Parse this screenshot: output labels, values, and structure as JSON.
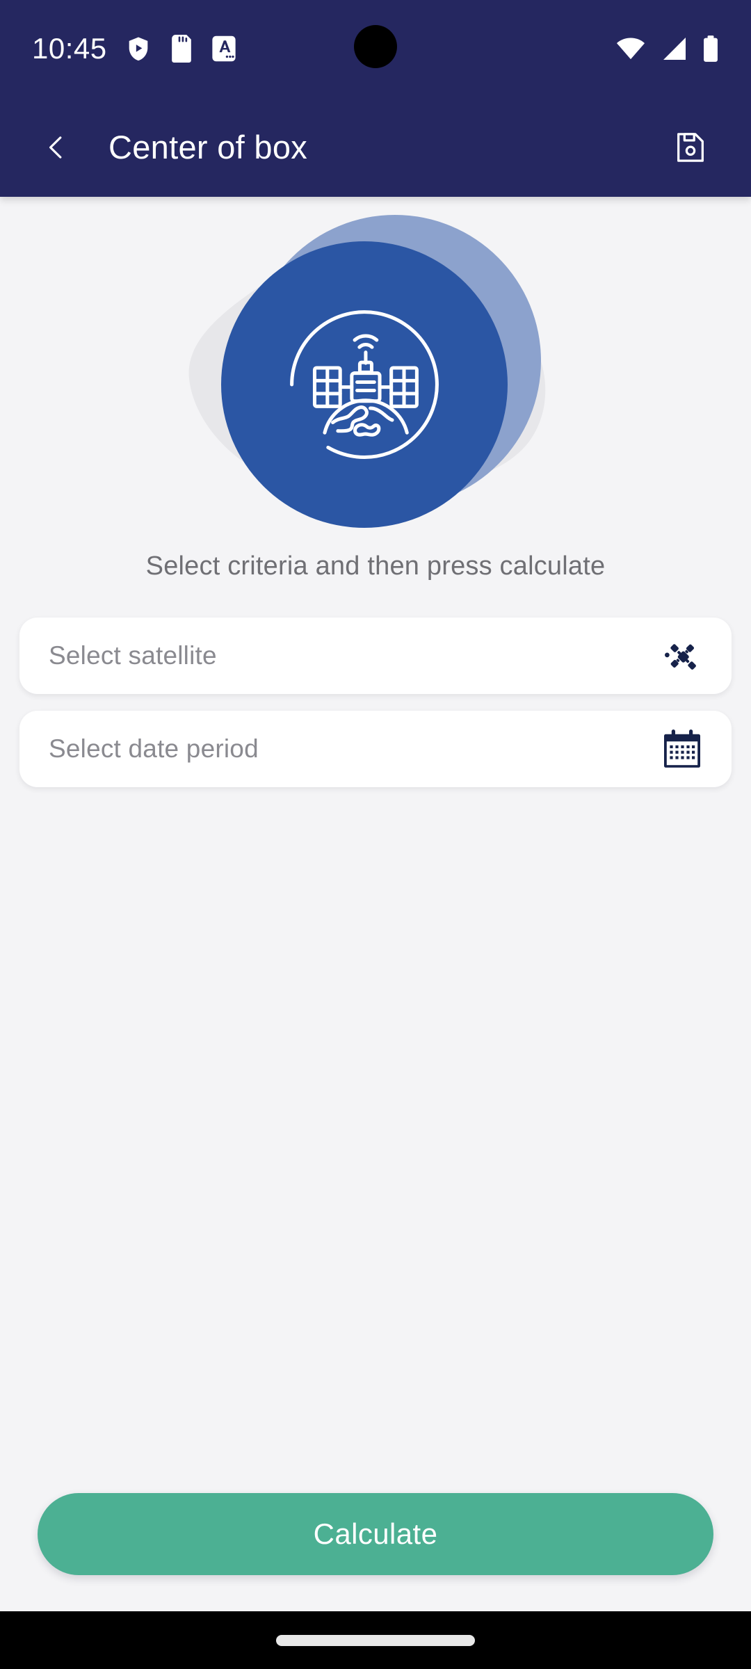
{
  "status_bar": {
    "time": "10:45",
    "left_icons": [
      {
        "name": "shield-play-icon"
      },
      {
        "name": "sd-card-icon"
      },
      {
        "name": "letter-a-badge-icon"
      }
    ],
    "right_icons": [
      {
        "name": "wifi-icon"
      },
      {
        "name": "cellular-signal-icon"
      },
      {
        "name": "battery-icon"
      }
    ],
    "background_color": "#252760",
    "foreground_color": "#ffffff"
  },
  "app_bar": {
    "back_label": "",
    "title": "Center of box",
    "save_icon": "save-floppy-icon",
    "background_color": "#252760"
  },
  "hero": {
    "icon": "satellite-orbiting-earth-icon",
    "blob_color": "#e7e7ea",
    "circle_back_color": "#8ca2cd",
    "circle_front_color": "#2b56a4"
  },
  "main": {
    "subtitle": "Select criteria and then press calculate",
    "fields": [
      {
        "id": "satellite",
        "label": "Select satellite",
        "value": "",
        "placeholder": "Select satellite",
        "icon": "satellite-icon"
      },
      {
        "id": "date-period",
        "label": "Select date period",
        "value": "",
        "placeholder": "Select date period",
        "icon": "calendar-icon"
      }
    ]
  },
  "footer": {
    "calculate_label": "Calculate",
    "calculate_color": "#4cb093"
  },
  "nav_bar": {
    "gesture_handle": "home-gesture-pill",
    "background_color": "#000000"
  }
}
